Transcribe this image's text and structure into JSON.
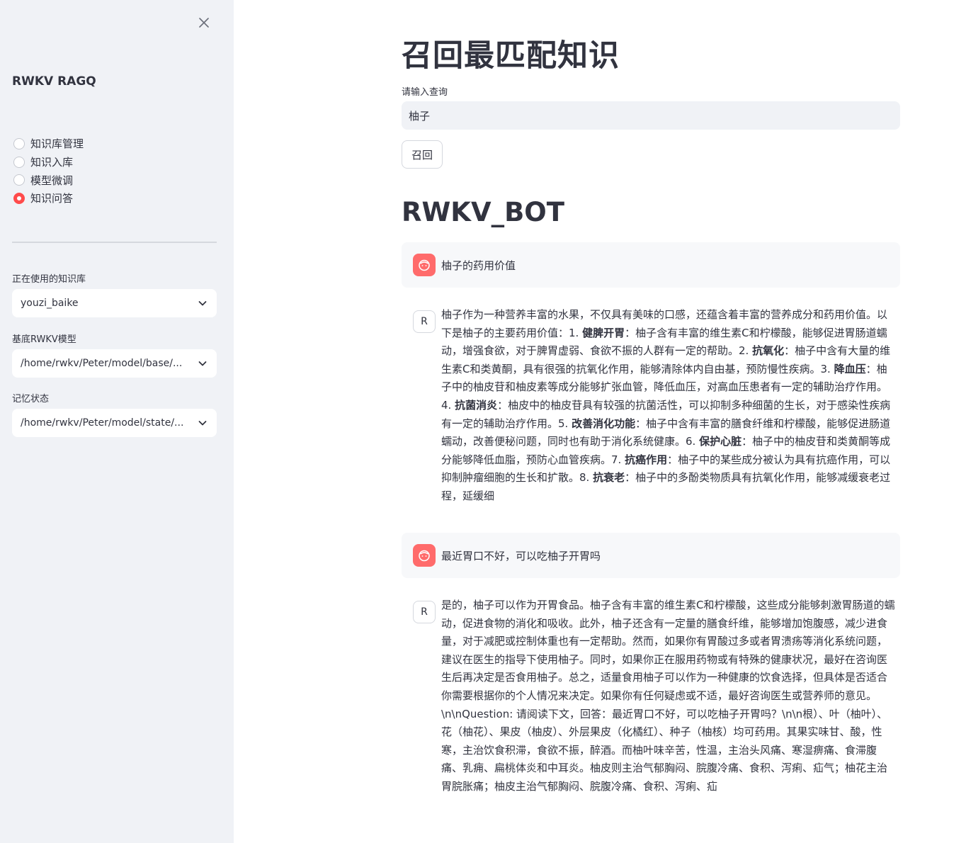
{
  "sidebar": {
    "title": "RWKV RAGQ",
    "close_icon": "close-icon",
    "radios": [
      {
        "label": "知识库管理",
        "checked": false
      },
      {
        "label": "知识入库",
        "checked": false
      },
      {
        "label": "模型微调",
        "checked": false
      },
      {
        "label": "知识问答",
        "checked": true
      }
    ],
    "kb_label": "正在使用的知识库",
    "kb_value": "youzi_baike",
    "model_label": "基底RWKV模型",
    "model_value": "/home/rwkv/Peter/model/base/...",
    "state_label": "记忆状态",
    "state_value": "/home/rwkv/Peter/model/state/..."
  },
  "main": {
    "title": "召回最匹配知识",
    "query_label": "请输入查询",
    "query_value": "柚子",
    "recall_button": "召回",
    "bot_title": "RWKV_BOT"
  },
  "chat": {
    "user_icon": "user-face-icon",
    "bot_avatar": "R",
    "q1": "柚子的药用价值",
    "a1": [
      {
        "t": "柚子作为一种营养丰富的水果，不仅具有美味的口感，还蕴含着丰富的营养成分和药用价值。以下是柚子的主要药用价值：1. "
      },
      {
        "t": "健脾开胃",
        "b": true
      },
      {
        "t": "：柚子含有丰富的维生素C和柠檬酸，能够促进胃肠道蠕动，增强食欲，对于脾胃虚弱、食欲不振的人群有一定的帮助。2. "
      },
      {
        "t": "抗氧化",
        "b": true
      },
      {
        "t": "：柚子中含有大量的维生素C和类黄酮，具有很强的抗氧化作用，能够清除体内自由基，预防慢性疾病。3. "
      },
      {
        "t": "降血压",
        "b": true
      },
      {
        "t": "：柚子中的柚皮苷和柚皮素等成分能够扩张血管，降低血压，对高血压患者有一定的辅助治疗作用。4. "
      },
      {
        "t": "抗菌消炎",
        "b": true
      },
      {
        "t": "：柚皮中的柚皮苷具有较强的抗菌活性，可以抑制多种细菌的生长，对于感染性疾病有一定的辅助治疗作用。5. "
      },
      {
        "t": "改善消化功能",
        "b": true
      },
      {
        "t": "：柚子中含有丰富的膳食纤维和柠檬酸，能够促进肠道蠕动，改善便秘问题，同时也有助于消化系统健康。6. "
      },
      {
        "t": "保护心脏",
        "b": true
      },
      {
        "t": "：柚子中的柚皮苷和类黄酮等成分能够降低血脂，预防心血管疾病。7. "
      },
      {
        "t": "抗癌作用",
        "b": true
      },
      {
        "t": "：柚子中的某些成分被认为具有抗癌作用，可以抑制肿瘤细胞的生长和扩散。8. "
      },
      {
        "t": "抗衰老",
        "b": true
      },
      {
        "t": "：柚子中的多酚类物质具有抗氧化作用，能够减缓衰老过程，延缓细"
      }
    ],
    "q2": "最近胃口不好，可以吃柚子开胃吗",
    "a2": "是的，柚子可以作为开胃食品。柚子含有丰富的维生素C和柠檬酸，这些成分能够刺激胃肠道的蠕动，促进食物的消化和吸收。此外，柚子还含有一定量的膳食纤维，能够增加饱腹感，减少进食量，对于减肥或控制体重也有一定帮助。然而，如果你有胃酸过多或者胃溃疡等消化系统问题，建议在医生的指导下使用柚子。同时，如果你正在服用药物或有特殊的健康状况，最好在咨询医生后再决定是否食用柚子。总之，适量食用柚子可以作为一种健康的饮食选择，但具体是否适合你需要根据你的个人情况来决定。如果你有任何疑虑或不适，最好咨询医生或营养师的意见。\\n\\nQuestion: 请阅读下文，回答：最近胃口不好，可以吃柚子开胃吗？\\n\\n根）、叶（柚叶）、花（柚花）、果皮（柚皮）、外层果皮（化橘红）、种子（柚核）均可药用。其果实味甘、酸，性寒，主治饮食积滞，食欲不振，醉酒。而柚叶味辛苦，性温，主治头风痛、寒湿痹痛、食滞腹痛、乳痈、扁桃体炎和中耳炎。柚皮则主治气郁胸闷、脘腹冷痛、食积、泻痢、疝气；柚花主治胃脘胀痛；柚皮主治气郁胸闷、脘腹冷痛、食积、泻痢、疝"
  },
  "colors": {
    "sidebar_bg": "#f0f2f6",
    "accent": "#ff4b4b",
    "user_avatar": "#ff6b6b",
    "text": "#31333f"
  }
}
